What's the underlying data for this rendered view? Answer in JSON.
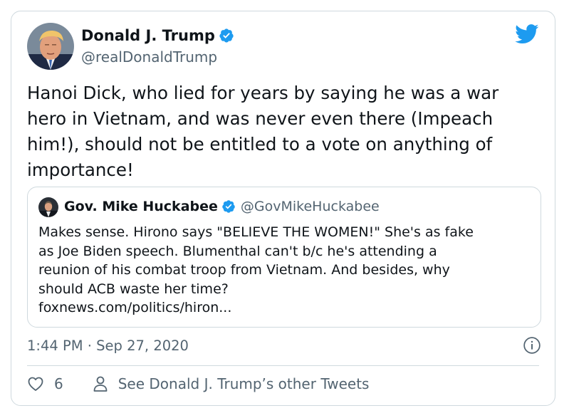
{
  "tweet": {
    "author_name": "Donald J. Trump",
    "author_handle": "@realDonaldTrump",
    "text": "Hanoi Dick, who lied for years by saying he was a war\nhero in Vietnam, and was never even there (Impeach\nhim!), should not be entitled to a vote on anything of\nimportance!",
    "timestamp": "1:44 PM · Sep 27, 2020",
    "like_count": "6",
    "other_tweets_label": "See Donald J. Trump’s other Tweets"
  },
  "quoted_tweet": {
    "author_name": "Gov. Mike Huckabee",
    "author_handle": "@GovMikeHuckabee",
    "text": "Makes sense. Hirono says \"BELIEVE THE WOMEN!\" She's as fake\nas Joe Biden speech.  Blumenthal can't b/c he's attending a\nreunion of his combat troop from Vietnam.  And besides, why\nshould ACB waste her time?\nfoxnews.com/politics/hiron..."
  },
  "icons": {
    "brand": "twitter-bird-icon",
    "verified": "verified-badge-icon",
    "info": "info-icon",
    "like": "heart-icon",
    "profile": "person-icon"
  },
  "colors": {
    "twitter_blue": "#1d9bf0",
    "text_primary": "#0f1419",
    "text_secondary": "#536471",
    "border": "#cfd9de"
  }
}
